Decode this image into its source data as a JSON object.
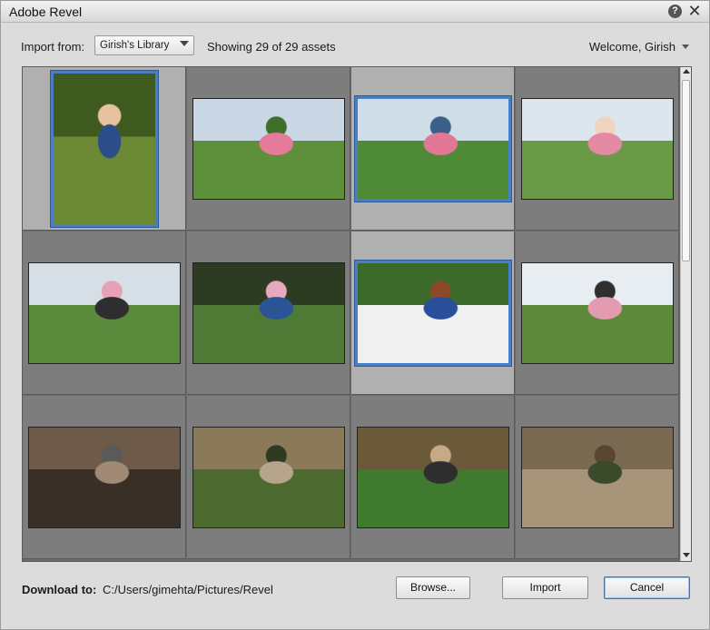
{
  "window": {
    "title": "Adobe Revel"
  },
  "titlebar": {
    "help_glyph": "?",
    "close_glyph": "✕"
  },
  "toolbar": {
    "import_label": "Import from:",
    "library_value": "Girish's Library",
    "showing_text": "Showing 29 of 29 assets",
    "welcome_text": "Welcome, Girish"
  },
  "grid": {
    "photos": [
      {
        "subject": "boy lying on grass, portrait",
        "selected": true,
        "orientation": "portrait"
      },
      {
        "subject": "girl in pink running on grass",
        "selected": false,
        "orientation": "landscape"
      },
      {
        "subject": "girl in pink running with boy behind",
        "selected": true,
        "orientation": "landscape"
      },
      {
        "subject": "close-up of smiling girl",
        "selected": false,
        "orientation": "landscape"
      },
      {
        "subject": "family walking on grass",
        "selected": false,
        "orientation": "landscape"
      },
      {
        "subject": "boy chasing girl on lawn",
        "selected": false,
        "orientation": "landscape"
      },
      {
        "subject": "father and son lying on grass with football",
        "selected": true,
        "orientation": "landscape"
      },
      {
        "subject": "parents with daughter on lawn",
        "selected": false,
        "orientation": "landscape"
      },
      {
        "subject": "mountain bikers on trail, close",
        "selected": false,
        "orientation": "landscape"
      },
      {
        "subject": "group of mountain bikers on trail",
        "selected": false,
        "orientation": "landscape"
      },
      {
        "subject": "two cyclists with helmet and camera",
        "selected": false,
        "orientation": "landscape"
      },
      {
        "subject": "cyclist on wooden bridge",
        "selected": false,
        "orientation": "landscape"
      }
    ]
  },
  "footer": {
    "download_label": "Download to:",
    "download_path": "C:/Users/gimehta/Pictures/Revel",
    "browse_label": "Browse...",
    "import_label": "Import",
    "cancel_label": "Cancel"
  },
  "colors": {
    "selection_border": "#4a7ec4",
    "grid_background": "#7d7d7d",
    "selected_cell": "#b0b0b0"
  }
}
